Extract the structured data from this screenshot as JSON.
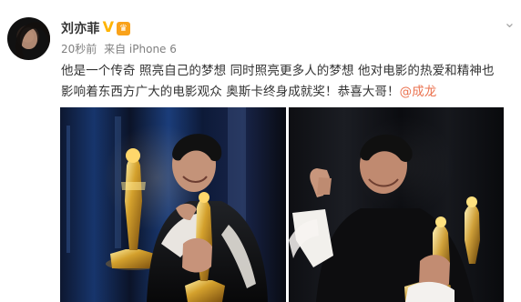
{
  "post": {
    "user": {
      "name": "刘亦菲",
      "verified_icon": "verified-v-icon",
      "vip_icon": "vip-crown-icon"
    },
    "meta": {
      "time": "20秒前",
      "source": "来自 iPhone 6"
    },
    "more_icon": "chevron-down-icon",
    "text_lines": [
      "他是一个传奇 照亮自己的梦想 同时照亮更多人的梦想 他对电影的热爱和精神也",
      "影响着东西方广大的电影观众 奥斯卡终身成就奖！恭喜大哥！"
    ],
    "mention": "@成龙",
    "images": [
      {
        "name": "jackie-chan-oscar-photo-left"
      },
      {
        "name": "jackie-chan-oscar-photo-right"
      }
    ],
    "colors": {
      "text": "#333333",
      "meta": "#808080",
      "mention": "#eb7350",
      "verified": "#ffb400",
      "vip": "#f9a21a"
    }
  }
}
